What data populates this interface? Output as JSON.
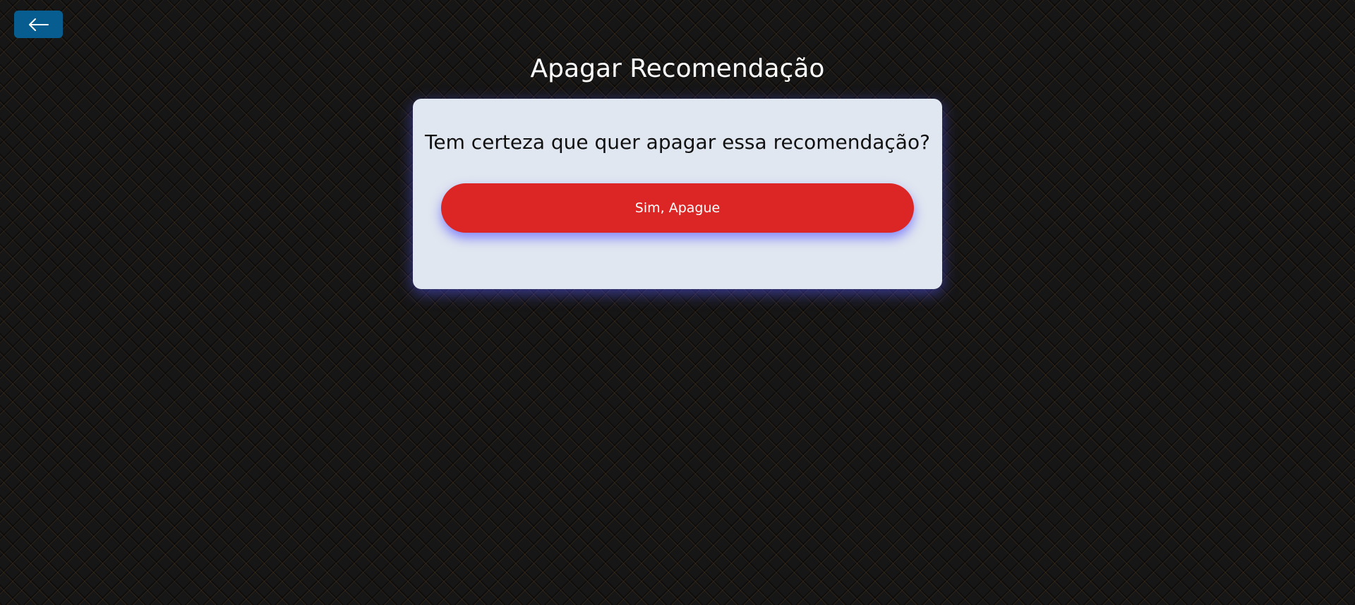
{
  "header": {
    "back_icon": "arrow-left-icon",
    "title": "Apagar Recomendação"
  },
  "dialog": {
    "question": "Tem certeza que quer apagar essa recomendação?",
    "confirm_label": "Sim, Apague"
  },
  "colors": {
    "background": "#161616",
    "back_button": "#075d8f",
    "card": "#e1e7f0",
    "confirm_button": "#dc2626",
    "glow": "#5a5aff"
  }
}
